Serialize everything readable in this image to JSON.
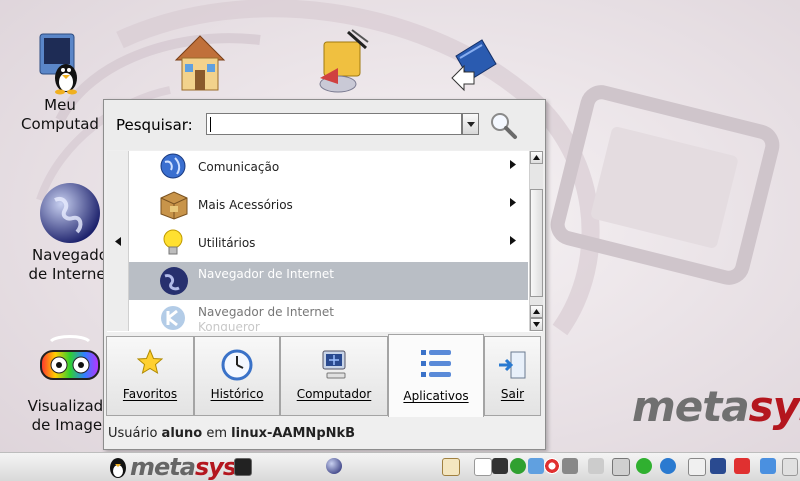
{
  "desktop": {
    "icons": [
      {
        "label": "Meu\nComputad",
        "icon": "computer-tux-icon"
      },
      {
        "label": "",
        "icon": "home-folder-icon"
      },
      {
        "label": "",
        "icon": "office-documents-icon"
      },
      {
        "label": "",
        "icon": "shortcut-book-icon"
      },
      {
        "label": "Navegado\nde Internet",
        "icon": "web-browser-globe-icon"
      },
      {
        "label": "Visualizado\nde Imager",
        "icon": "image-viewer-glasses-icon"
      }
    ],
    "logo": {
      "meta": "meta",
      "sys": "sys"
    }
  },
  "menu": {
    "search_label": "Pesquisar:",
    "search_value": "",
    "items": [
      {
        "label": "Comunicação",
        "icon": "globe-icon",
        "has_submenu": true
      },
      {
        "label": "Mais Acessórios",
        "icon": "package-box-icon",
        "has_submenu": true
      },
      {
        "label": "Utilitários",
        "icon": "lightbulb-icon",
        "has_submenu": true
      },
      {
        "label": "Navegador de Internet",
        "icon": "globe-icon",
        "selected": true
      },
      {
        "label": "Navegador de Internet",
        "sublabel": "Konqueror",
        "icon": "konqueror-icon"
      }
    ],
    "tabs": [
      {
        "label": "Favoritos",
        "icon": "star-icon"
      },
      {
        "label": "Histórico",
        "icon": "clock-icon"
      },
      {
        "label": "Computador",
        "icon": "computer-icon"
      },
      {
        "label": "Aplicativos",
        "icon": "applications-list-icon",
        "active": true
      },
      {
        "label": "Sair",
        "icon": "logout-door-icon"
      }
    ],
    "user_line": {
      "prefix": "Usuário",
      "user": "aluno",
      "mid": "em",
      "host": "linux-AAMNpNkB"
    }
  },
  "taskbar": {
    "logo": {
      "meta": "meta",
      "sys": "sys"
    },
    "tray_icons": [
      "terminal-icon",
      "globe-icon",
      "kde-icon",
      "media-icon",
      "network-icon",
      "lifebuoy-icon",
      "tools-icon",
      "volume-icon",
      "battery-icon",
      "green-circle-icon",
      "blue-circle-icon",
      "mail-icon",
      "stop-icon",
      "arrow-icon",
      "close-icon",
      "update-icon"
    ]
  },
  "colors": {
    "selection": "#b9bec5",
    "brand_red": "#b4161e",
    "brand_gray": "#707070"
  }
}
